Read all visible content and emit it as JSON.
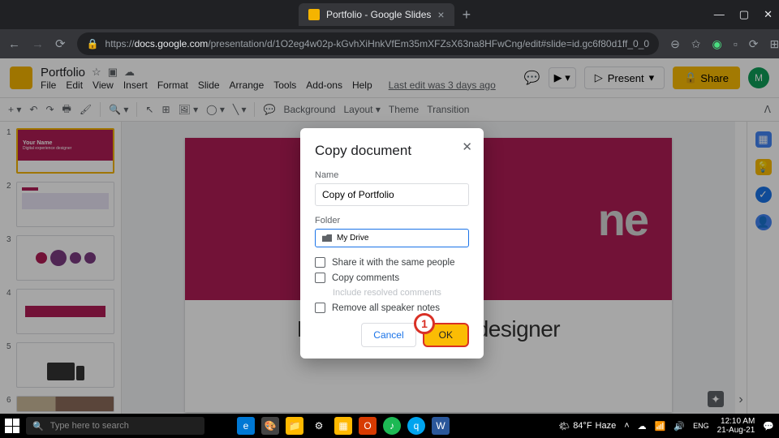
{
  "browser": {
    "tab_title": "Portfolio - Google Slides",
    "url_host": "docs.google.com",
    "url_path": "/presentation/d/1O2eg4w02p-kGvhXiHnkVfEm35mXFZsX63na8HFwCng/edit#slide=id.gc6f80d1ff_0_0",
    "url_prefix": "https://"
  },
  "slides": {
    "doc_title": "Portfolio",
    "last_edit": "Last edit was 3 days ago",
    "menus": [
      "File",
      "Edit",
      "View",
      "Insert",
      "Format",
      "Slide",
      "Arrange",
      "Tools",
      "Add-ons",
      "Help"
    ],
    "present": "Present",
    "share": "Share",
    "user_initial": "M",
    "toolbar": {
      "background": "Background",
      "layout": "Layout",
      "theme": "Theme",
      "transition": "Transition"
    },
    "thumbs": [
      {
        "n": "1",
        "title": "Your Name",
        "sub": "Digital experience designer"
      },
      {
        "n": "2"
      },
      {
        "n": "3"
      },
      {
        "n": "4"
      },
      {
        "n": "5"
      },
      {
        "n": "6"
      }
    ],
    "slide_hero_text": "ne",
    "slide_sub_text": "Digital experience designer"
  },
  "dialog": {
    "title": "Copy document",
    "name_label": "Name",
    "name_value": "Copy of Portfolio",
    "folder_label": "Folder",
    "folder_value": "My Drive",
    "opt_share": "Share it with the same people",
    "opt_comments": "Copy comments",
    "opt_resolved": "Include resolved comments",
    "opt_notes": "Remove all speaker notes",
    "cancel": "Cancel",
    "ok": "OK",
    "callout": "1"
  },
  "taskbar": {
    "search_placeholder": "Type here to search",
    "weather_temp": "84°F",
    "weather_cond": "Haze",
    "time": "12:10 AM",
    "date": "21-Aug-21"
  }
}
